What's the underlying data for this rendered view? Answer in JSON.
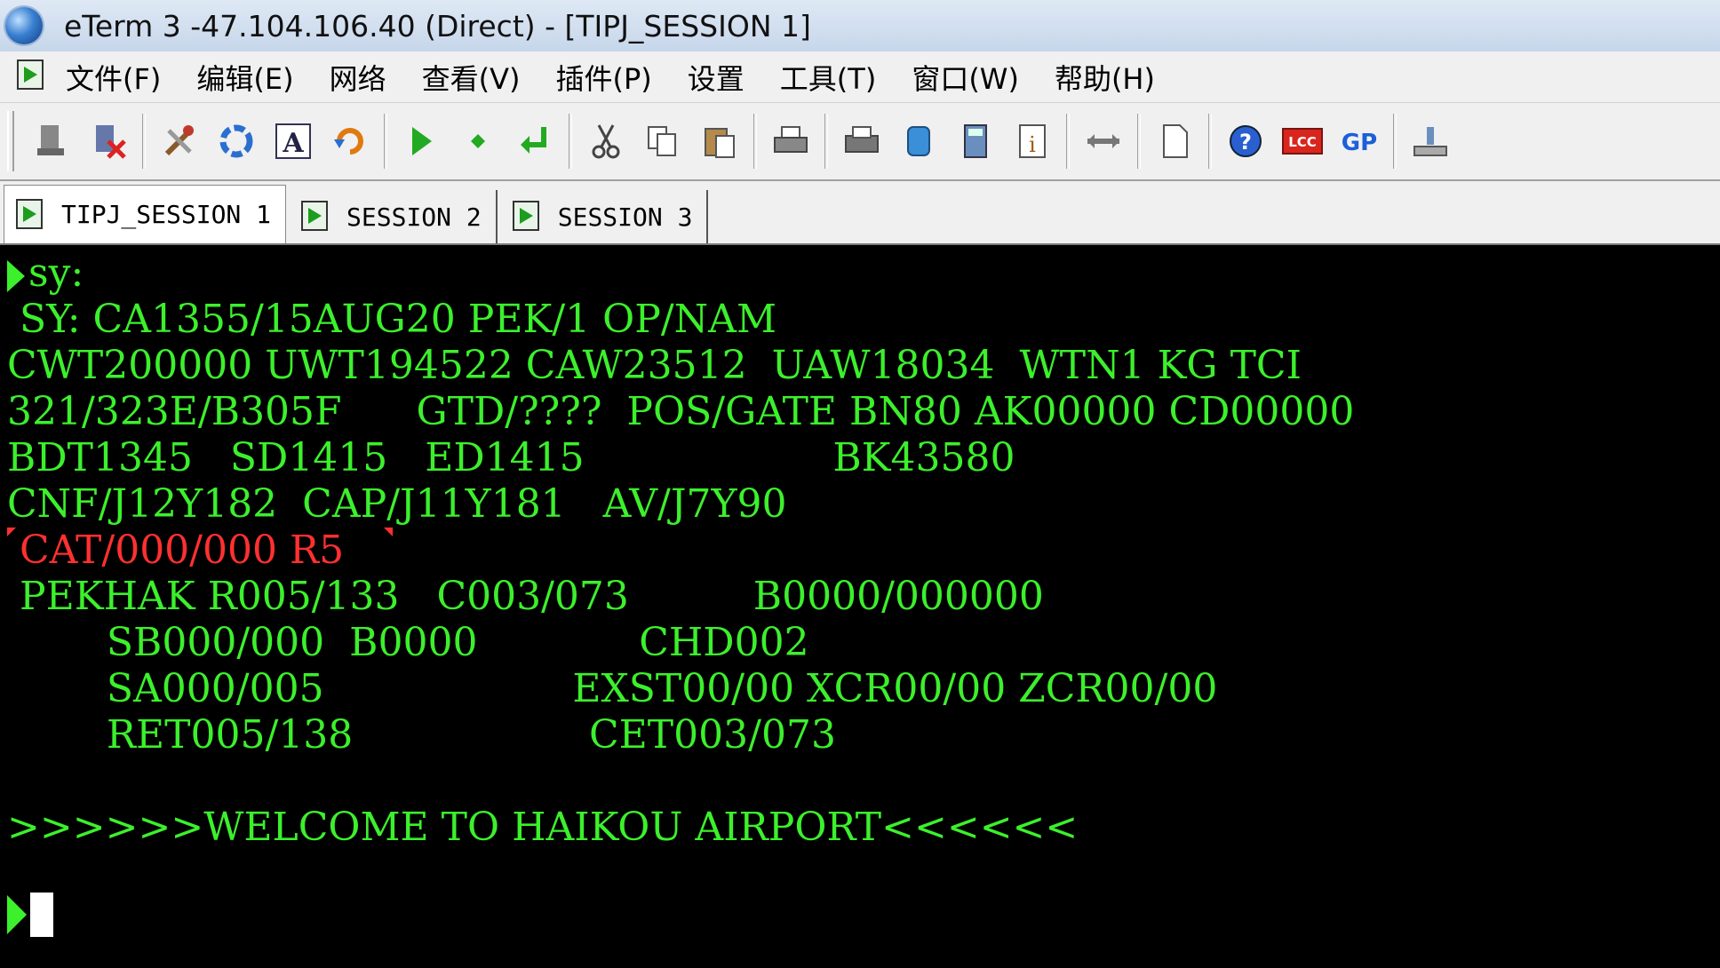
{
  "window": {
    "title": "eTerm 3 -47.104.106.40 (Direct) - [TIPJ_SESSION 1]"
  },
  "menu": {
    "items": [
      "文件(F)",
      "编辑(E)",
      "网络",
      "查看(V)",
      "插件(P)",
      "设置",
      "工具(T)",
      "窗口(W)",
      "帮助(H)"
    ]
  },
  "toolbar": {
    "buttons": [
      "connect-icon",
      "disconnect-icon",
      "tools-icon",
      "refresh-icon",
      "font-icon",
      "reconnect-icon",
      "play-icon",
      "diamond-icon",
      "return-icon",
      "cut-icon",
      "copy-icon",
      "paste-icon",
      "print-icon",
      "print-preview-icon",
      "database-icon",
      "calculator-icon",
      "info-icon",
      "transfer-icon",
      "page-icon",
      "help-icon",
      "lcc-icon",
      "gp-icon",
      "upload-icon"
    ],
    "lcc_label": "LCC",
    "gp_label": "GP"
  },
  "tabs": [
    {
      "label": "TIPJ_SESSION 1",
      "active": true
    },
    {
      "label": "SESSION 2",
      "active": false
    },
    {
      "label": "SESSION 3",
      "active": false
    }
  ],
  "terminal": {
    "text_color": "#3cf02c",
    "alert_color": "#ff3030",
    "lines": [
      "sy:",
      " SY: CA1355/15AUG20 PEK/1 OP/NAM",
      "CWT200000 UWT194522 CAW23512  UAW18034  WTN1 KG TCI",
      "321/323E/B305F      GTD/????  POS/GATE BN80 AK00000 CD00000",
      "BDT1345   SD1415   ED1415                    BK43580",
      "CNF/J12Y182  CAP/J11Y181   AV/J7Y90",
      " CAT/000/000 R5",
      " PEKHAK R005/133   C003/073          B0000/000000",
      "        SB000/000  B0000             CHD002",
      "        SA000/005                    EXST00/00 XCR00/00 ZCR00/00",
      "        RET005/138                   CET003/073",
      "",
      ">>>>>>WELCOME TO HAIKOU AIRPORT<<<<<<"
    ]
  }
}
